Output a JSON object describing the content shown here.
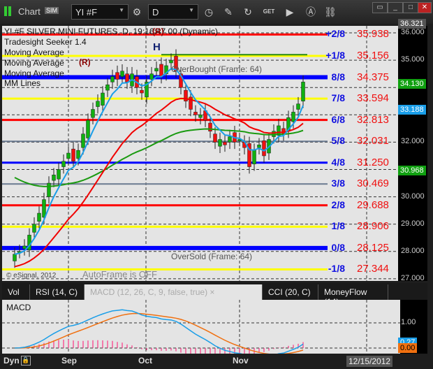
{
  "window": {
    "title": "Chart",
    "sim_badge": "SIM",
    "symbol": "YI #F",
    "interval": "D"
  },
  "toolbar_icons": [
    "settings-gear-icon",
    "clock-icon",
    "pencil-icon",
    "refresh-icon",
    "get-icon",
    "play-icon",
    "a-circle-icon",
    "link-icon"
  ],
  "chart": {
    "header": "YI #F SILVER MINI FUTURES, D, 19:16:47.00 (Dynamic)",
    "studies": [
      "Tradesight Seeker 1.4",
      "Moving Average",
      "Moving Average",
      "Moving Average",
      "MM Lines"
    ],
    "overbought": "OverBought (Frame: 64)",
    "oversold": "OverSold (Frame: 64)",
    "autoframe": "AutoFrame is OFF",
    "copyright": "© eSignal, 2012",
    "markers": {
      "h": "H",
      "r1": "(R)",
      "r2": "(R)"
    },
    "mm_lines": [
      {
        "label": "+2/8",
        "value": "35.938",
        "price": 35.938,
        "color": "#ff0000"
      },
      {
        "label": "+1/8",
        "value": "35.156",
        "price": 35.156,
        "color": "#ffff00"
      },
      {
        "label": "8/8",
        "value": "34.375",
        "price": 34.375,
        "color": "#0000ff"
      },
      {
        "label": "7/8",
        "value": "33.594",
        "price": 33.594,
        "color": "#ffff00"
      },
      {
        "label": "6/8",
        "value": "32.813",
        "price": 32.813,
        "color": "#ff0000"
      },
      {
        "label": "5/8",
        "value": "32.031",
        "price": 32.031,
        "color": "#6a7a90"
      },
      {
        "label": "4/8",
        "value": "31.250",
        "price": 31.25,
        "color": "#0000ff"
      },
      {
        "label": "3/8",
        "value": "30.469",
        "price": 30.469,
        "color": "#6a7a90"
      },
      {
        "label": "2/8",
        "value": "29.688",
        "price": 29.688,
        "color": "#ff0000"
      },
      {
        "label": "1/8",
        "value": "28.906",
        "price": 28.906,
        "color": "#ffff00"
      },
      {
        "label": "0/8",
        "value": "28.125",
        "price": 28.125,
        "color": "#0000ff"
      },
      {
        "label": "-1/8",
        "value": "27.344",
        "price": 27.344,
        "color": "#ffff00"
      }
    ],
    "price_ticks": [
      "36.000",
      "35.000",
      "32.000",
      "30.000",
      "29.000",
      "28.000",
      "27.000"
    ],
    "tags": {
      "high": "36.321",
      "last": "34.130",
      "ma_blue": "33.188",
      "ma_green": "30.968"
    },
    "closes": [
      27.9,
      28.0,
      28.2,
      28.6,
      29.0,
      29.4,
      29.9,
      30.5,
      30.8,
      31.0,
      31.3,
      31.6,
      31.3,
      31.7,
      32.3,
      32.8,
      33.2,
      33.5,
      33.8,
      34.1,
      34.4,
      34.3,
      34.6,
      34.2,
      34.5,
      34.0,
      33.8,
      34.2,
      34.5,
      34.7,
      34.4,
      34.8,
      35.0,
      34.6,
      34.0,
      33.5,
      33.2,
      33.0,
      33.0,
      32.8,
      32.4,
      32.0,
      32.1,
      31.9,
      32.2,
      32.0,
      32.1,
      31.8,
      31.1,
      31.7,
      31.9,
      31.5,
      32.1,
      32.4,
      32.6,
      32.3,
      32.9,
      33.1,
      33.4,
      34.2
    ]
  },
  "indicator_tabs": [
    {
      "label": "Vol",
      "active": false
    },
    {
      "label": "RSI (14, C)",
      "active": false
    },
    {
      "label": "MACD (12, 26, C, 9, false, true)",
      "active": true
    },
    {
      "label": "CCI (20, C)",
      "active": false
    },
    {
      "label": "MoneyFlow (14)",
      "active": false
    }
  ],
  "macd": {
    "title": "MACD",
    "tick": "1.00",
    "tag_macd": "0.27",
    "tag_signal": "0.00"
  },
  "xaxis": {
    "months": [
      "Sep",
      "Oct",
      "Nov"
    ],
    "date": "12/15/2012",
    "dyn": "Dyn"
  }
}
